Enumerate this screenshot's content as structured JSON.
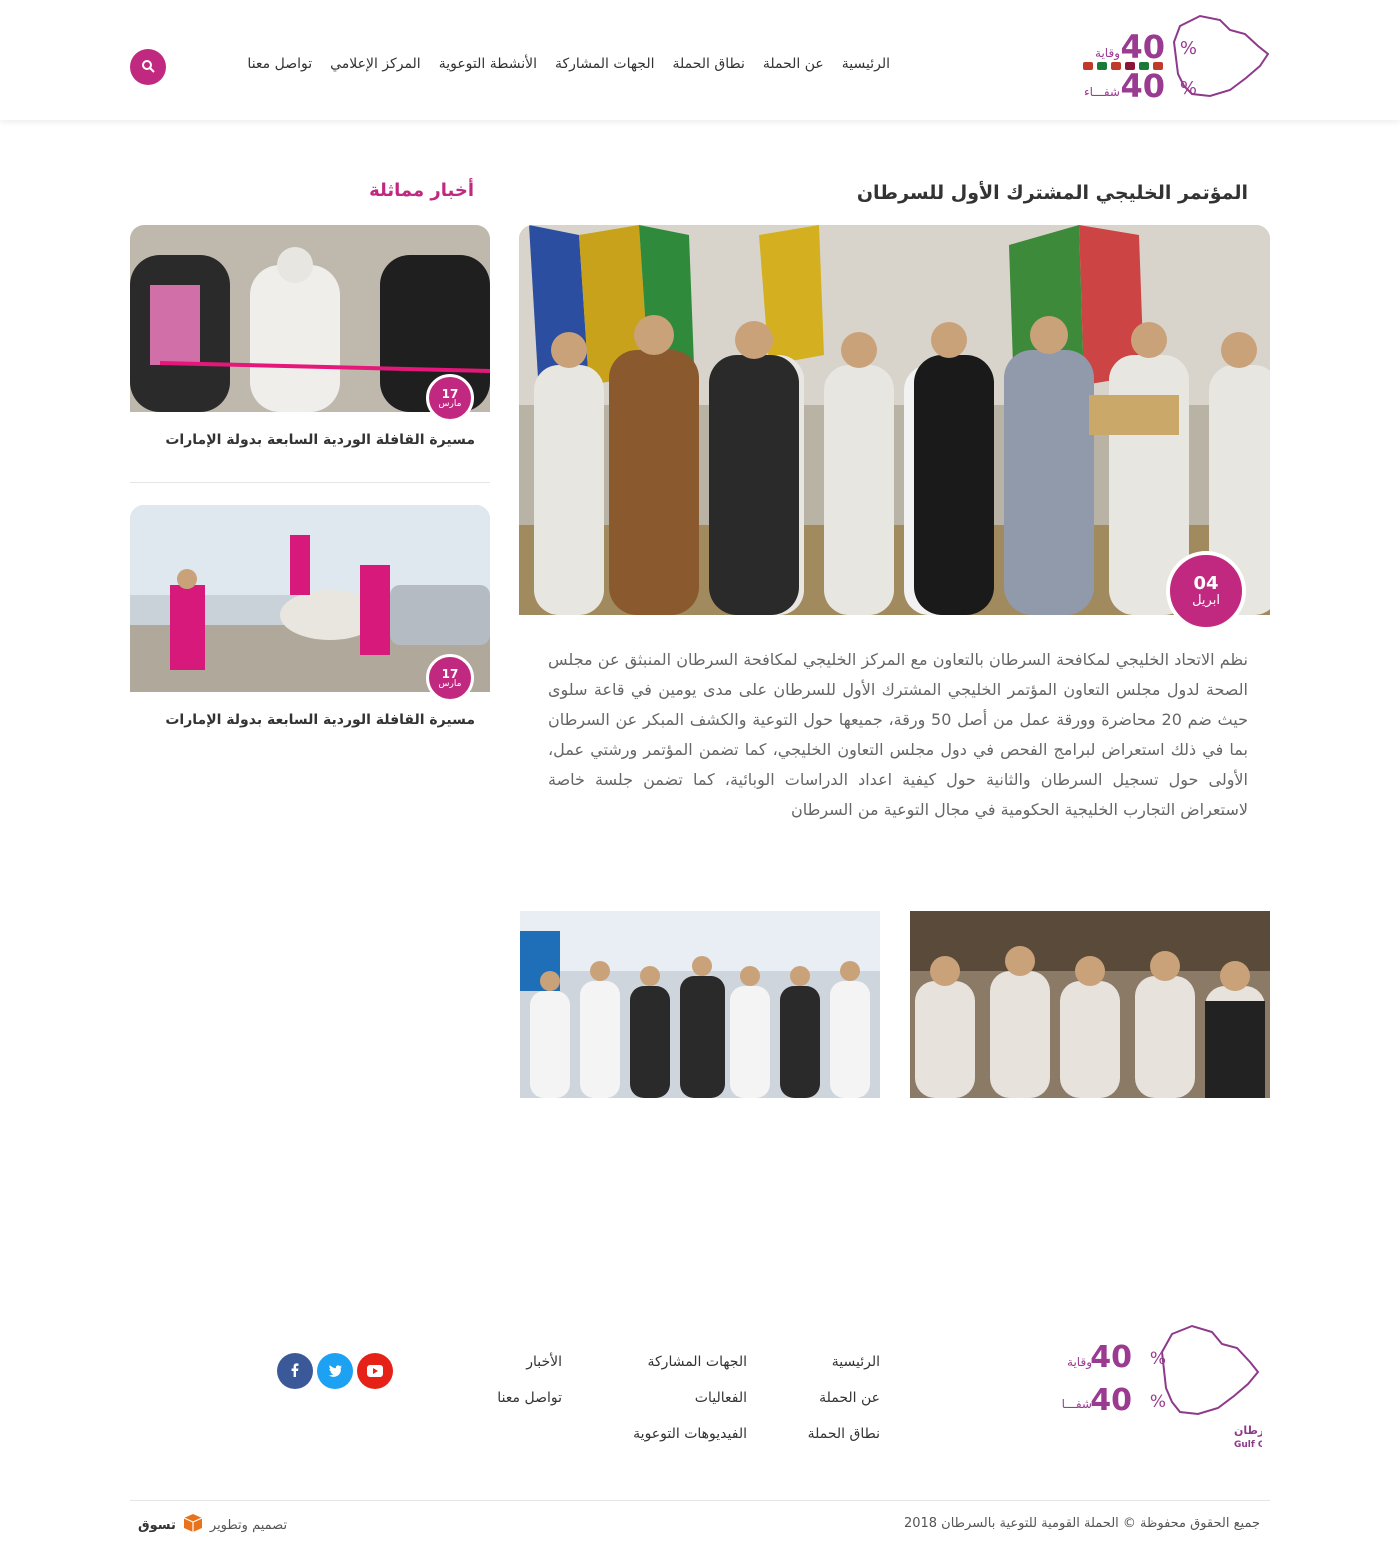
{
  "nav": {
    "items": [
      "الرئيسية",
      "عن الحملة",
      "نطاق الحملة",
      "الجهات المشاركة",
      "الأنشطة التوعوية",
      "المركز الإعلامي",
      "تواصل معنا"
    ]
  },
  "logo": {
    "top_text": "وقاية",
    "bottom_text": "شفـــاء",
    "number": "40",
    "percent": "%"
  },
  "article": {
    "title": "المؤتمر الخليجي المشترك الأول للسرطان",
    "date_day": "04",
    "date_month": "ابريل",
    "body": "نظم الاتحاد الخليجي لمكافحة السرطان بالتعاون مع المركز الخليجي لمكافحة السرطان المنبثق عن مجلس الصحة لدول مجلس التعاون المؤتمر الخليجي المشترك الأول للسرطان على مدى يومين في قاعة سلوى حيث ضم 20 محاضرة وورقة عمل من أصل 50 ورقة، جميعها حول التوعية والكشف المبكر عن السرطان بما في ذلك استعراض لبرامج الفحص في دول مجلس التعاون الخليجي، كما تضمن المؤتمر ورشتي عمل، الأولى حول تسجيل السرطان والثانية حول كيفية اعداد الدراسات الوبائية، كما تضمن جلسة خاصة لاستعراض التجارب الخليجية الحكومية في مجال التوعية من السرطان"
  },
  "related": {
    "title": "أخبار مماثلة",
    "items": [
      {
        "day": "17",
        "month": "مارس",
        "caption": "مسيرة القافلة الوردية السابعة بدولة الإمارات"
      },
      {
        "day": "17",
        "month": "مارس",
        "caption": "مسيرة القافلة الوردية السابعة بدولة الإمارات"
      }
    ]
  },
  "footer": {
    "logo_ar": "الحملة الخليجية للتوعية بالسرطان",
    "logo_en": "Gulf Campaign for Cancer Awareness",
    "col1": [
      "الرئيسية",
      "عن الحملة",
      "نطاق الحملة"
    ],
    "col2": [
      "الجهات المشاركة",
      "الفعاليات",
      "الفيديوهات التوعوية"
    ],
    "col3": [
      "الأخبار",
      "تواصل معنا"
    ],
    "copyright": "جميع الحقوق محفوظة © الحملة القومية للتوعية بالسرطان 2018",
    "credit": "تصميم وتطوير",
    "credit_brand": "تسوق"
  },
  "colors": {
    "accent": "#c0297f",
    "facebook": "#3b5998",
    "twitter": "#1da1f2",
    "youtube": "#e62117"
  },
  "icons": [
    "search-icon",
    "facebook-icon",
    "twitter-icon",
    "youtube-icon"
  ]
}
